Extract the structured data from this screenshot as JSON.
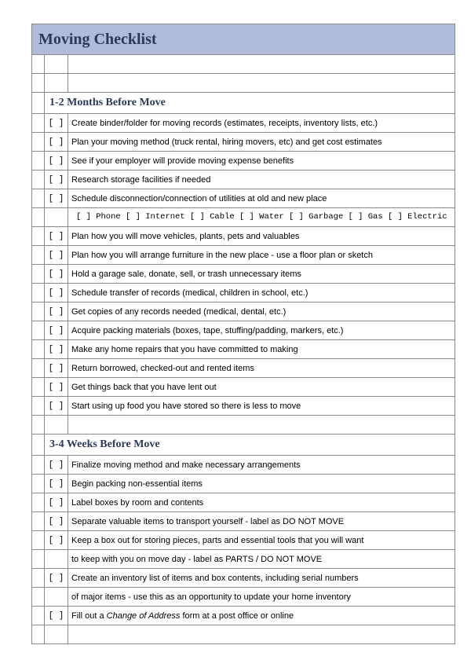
{
  "title": "Moving Checklist",
  "checkbox": "[  ]",
  "sections": [
    {
      "heading": "1-2 Months Before Move",
      "items": [
        {
          "text": "Create binder/folder for moving records (estimates, receipts, inventory lists, etc.)"
        },
        {
          "text": "Plan your moving method (truck rental, hiring movers, etc) and get cost estimates"
        },
        {
          "text": "See if your employer will provide moving expense benefits"
        },
        {
          "text": "Research storage facilities if needed"
        },
        {
          "text": "Schedule disconnection/connection of utilities at old and new place",
          "sub": "[  ] Phone   [  ] Internet   [  ] Cable   [  ] Water   [  ] Garbage   [  ] Gas   [  ] Electric"
        },
        {
          "text": "Plan how you will move vehicles, plants, pets and valuables"
        },
        {
          "text": "Plan how you will arrange furniture in the new place - use a floor plan or sketch"
        },
        {
          "text": "Hold a garage sale, donate, sell, or trash unnecessary items"
        },
        {
          "text": "Schedule transfer of records (medical, children in school, etc.)"
        },
        {
          "text": "Get copies of any records needed (medical, dental, etc.)"
        },
        {
          "text": "Acquire packing materials (boxes, tape, stuffing/padding, markers, etc.)"
        },
        {
          "text": "Make any home repairs that you have committed to making"
        },
        {
          "text": "Return borrowed, checked-out and rented items"
        },
        {
          "text": "Get things back that you have lent out"
        },
        {
          "text": "Start using up food you have stored so there is less to move"
        }
      ]
    },
    {
      "heading": "3-4 Weeks Before Move",
      "items": [
        {
          "text": "Finalize moving method and make necessary arrangements"
        },
        {
          "text": "Begin packing non-essential items"
        },
        {
          "text": "Label boxes by room and contents"
        },
        {
          "text": "Separate valuable items to transport yourself - label as DO NOT MOVE"
        },
        {
          "text": "Keep a box out for storing pieces, parts and essential tools that you will want",
          "cont": "to keep with you on move day - label as PARTS / DO NOT MOVE"
        },
        {
          "text": "Create an inventory list of items and box contents, including serial numbers",
          "cont": "of major items - use this as an opportunity to update your home inventory"
        },
        {
          "text_html": "Fill out a <span class=\"italic\">Change of Address</span> form at a post office or online",
          "text": "Fill out a Change of Address form at a post office or online"
        }
      ]
    }
  ]
}
